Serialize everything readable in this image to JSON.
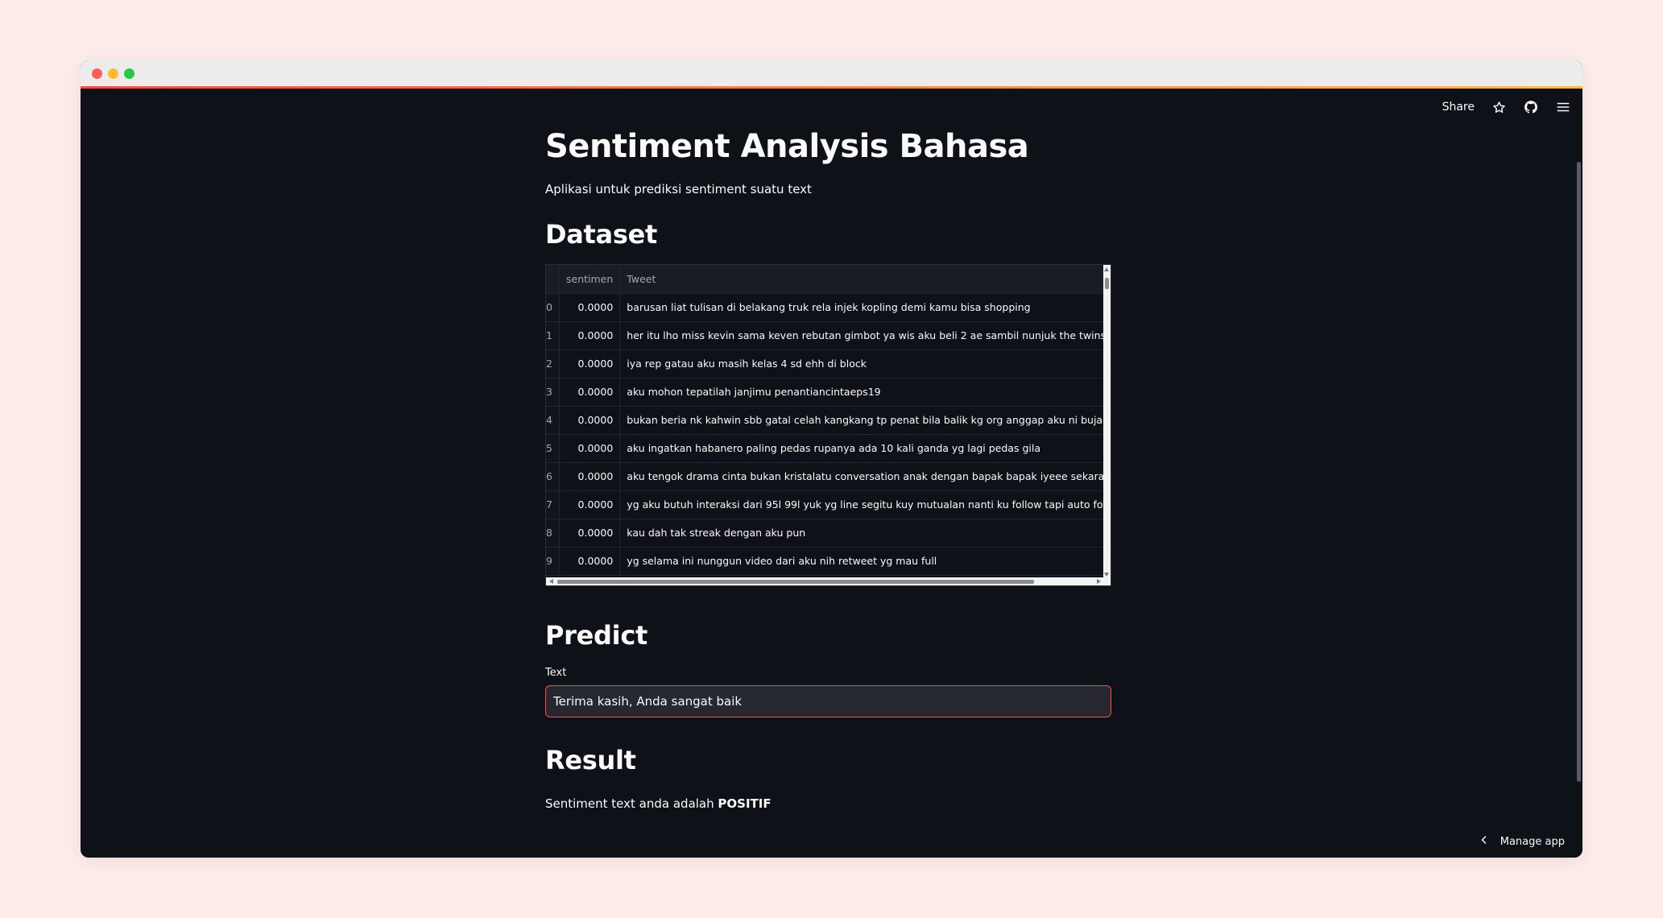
{
  "app": {
    "title": "Sentiment Analysis Bahasa",
    "subtitle": "Aplikasi untuk prediksi sentiment suatu text"
  },
  "topnav": {
    "share_label": "Share",
    "icons": [
      "star-icon",
      "github-icon",
      "menu-icon"
    ]
  },
  "dataset": {
    "heading": "Dataset",
    "columns": [
      "",
      "sentimen",
      "Tweet"
    ],
    "rows": [
      {
        "index": "0",
        "sentimen": "0.0000",
        "tweet": "barusan liat tulisan di belakang truk rela injek kopling demi kamu bisa shopping"
      },
      {
        "index": "1",
        "sentimen": "0.0000",
        "tweet": "her itu lho miss kevin sama keven rebutan gimbot ya wis aku beli 2 ae sambil nunjuk the twins yg"
      },
      {
        "index": "2",
        "sentimen": "0.0000",
        "tweet": "iya rep gatau aku masih kelas 4 sd ehh di block"
      },
      {
        "index": "3",
        "sentimen": "0.0000",
        "tweet": "aku mohon tepatilah janjimu penantiancintaeps19"
      },
      {
        "index": "4",
        "sentimen": "0.0000",
        "tweet": "bukan beria nk kahwin sbb gatal celah kangkang tp penat bila balik kg org anggap aku ni bujang t"
      },
      {
        "index": "5",
        "sentimen": "0.0000",
        "tweet": "aku ingatkan habanero paling pedas rupanya ada 10 kali ganda yg lagi pedas gila"
      },
      {
        "index": "6",
        "sentimen": "0.0000",
        "tweet": "aku tengok drama cinta bukan kristalatu conversation anak dengan bapak bapak iyeee sekarang"
      },
      {
        "index": "7",
        "sentimen": "0.0000",
        "tweet": "yg aku butuh interaksi dari 95l 99l yuk yg line segitu kuy mutualan nanti ku follow tapi auto follov"
      },
      {
        "index": "8",
        "sentimen": "0.0000",
        "tweet": "kau dah tak streak dengan aku pun"
      },
      {
        "index": "9",
        "sentimen": "0.0000",
        "tweet": "yg selama ini nunggun video dari aku nih retweet yg mau full"
      }
    ]
  },
  "predict": {
    "heading": "Predict",
    "input_label": "Text",
    "input_value": "Terima kasih, Anda sangat baik"
  },
  "result": {
    "heading": "Result",
    "prefix": "Sentiment text anda adalah ",
    "value": "POSITIF"
  },
  "footer": {
    "manage_label": "Manage app"
  },
  "colors": {
    "background": "#0e1117",
    "primary": "#ff4b4b",
    "input_bg": "#262730"
  }
}
